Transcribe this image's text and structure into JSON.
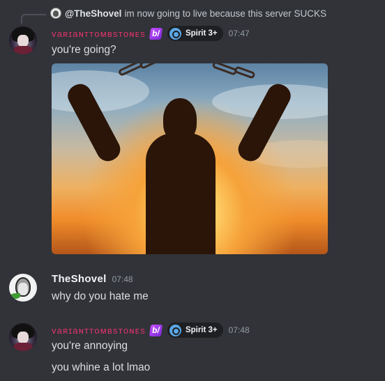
{
  "reply": {
    "mention": "@TheShovel",
    "text": "im now going to live because this server SUCKS"
  },
  "messages": [
    {
      "author": "vaʀɪaɴᴛᴛoᴍʙsᴛoɴᴇs",
      "boost_badge": "b/",
      "clan_tag": "Spirit 3+",
      "time": "07:47",
      "text": "you're going?",
      "has_image": true
    },
    {
      "author": "TheShovel",
      "time": "07:48",
      "text": "why do you hate me"
    },
    {
      "author": "vaʀɪaɴᴛᴛoᴍʙsᴛoɴᴇs",
      "boost_badge": "b/",
      "clan_tag": "Spirit 3+",
      "time": "07:48",
      "lines": [
        "you're annoying",
        "you whine a lot lmao"
      ]
    }
  ],
  "colors": {
    "background": "#313338",
    "variant_name": "#e3336b",
    "timestamp": "#949ba4",
    "text": "#dbdee1"
  },
  "icons": {
    "boost": "nitro-boost-icon",
    "clan": "clan-badge-icon",
    "reply": "reply-spine"
  }
}
